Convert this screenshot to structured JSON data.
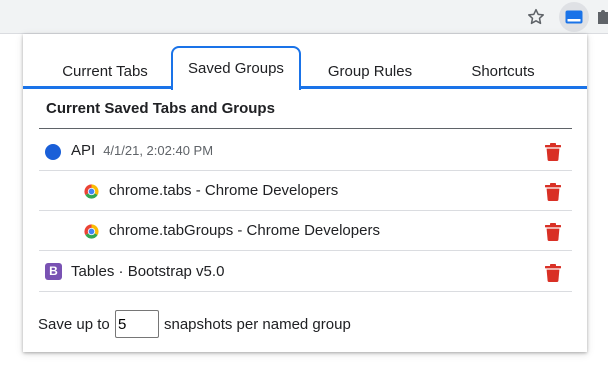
{
  "tabs": [
    {
      "label": "Current Tabs"
    },
    {
      "label": "Saved Groups"
    },
    {
      "label": "Group Rules"
    },
    {
      "label": "Shortcuts"
    }
  ],
  "active_tab": "Saved Groups",
  "section": {
    "title": "Current Saved Tabs and Groups"
  },
  "groups": [
    {
      "name": "API",
      "timestamp": "4/1/21, 2:02:40 PM",
      "color": "#1a5fd8",
      "tabs": [
        {
          "title": "chrome.tabs - Chrome Developers",
          "icon": "chrome-icon"
        },
        {
          "title": "chrome.tabGroups - Chrome Developers",
          "icon": "chrome-icon"
        }
      ]
    }
  ],
  "ungrouped": [
    {
      "title": "Tables · Bootstrap v5.0",
      "icon": "bootstrap-icon",
      "icon_glyph": "B",
      "icon_color": "#7952b3"
    }
  ],
  "footer": {
    "prefix": "Save up to",
    "value": "5",
    "suffix": "snapshots per named group"
  },
  "colors": {
    "accent": "#1a73e8",
    "delete": "#d93025"
  }
}
